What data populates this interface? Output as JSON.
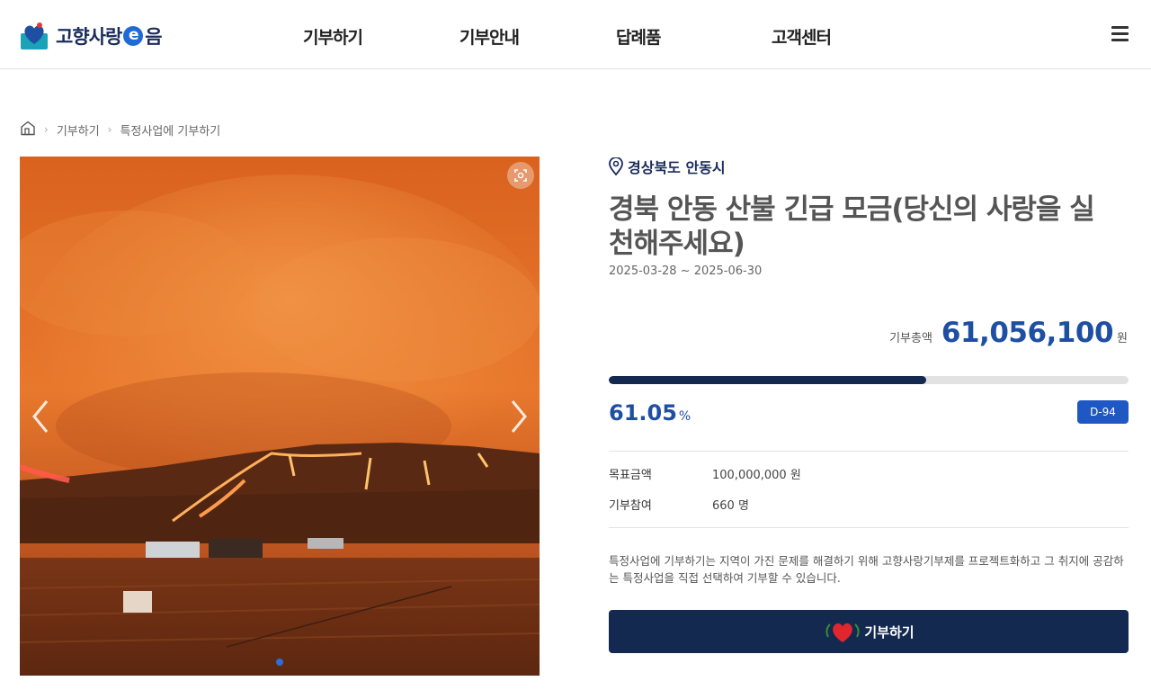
{
  "header": {
    "logo_text_1": "고향사랑",
    "logo_e": "e",
    "logo_text_2": "음",
    "nav": [
      "기부하기",
      "기부안내",
      "답례품",
      "고객센터"
    ],
    "menu_icon": "hamburger-icon"
  },
  "breadcrumb": {
    "home_icon": "home-icon",
    "items": [
      "기부하기",
      "특정사업에 기부하기"
    ]
  },
  "slider": {
    "zoom_icon": "zoom-icon",
    "prev_icon": "chevron-left-icon",
    "next_icon": "chevron-right-icon",
    "active_index": 1,
    "total": 1
  },
  "project": {
    "region": "경상북도 안동시",
    "title": "경북 안동 산불 긴급 모금(당신의 사랑을 실천해주세요)",
    "period": "2025-03-28 ~ 2025-06-30",
    "total_label": "기부총액",
    "total_value": "61,056,100",
    "total_unit": "원",
    "progress_percent": 61.05,
    "percent_value": "61.05",
    "percent_unit": "%",
    "dday": "D-94",
    "target_label": "목표금액",
    "target_value": "100,000,000 원",
    "participants_label": "기부참여",
    "participants_value": "660 명",
    "description": "특정사업에 기부하기는 지역이 가진 문제를 해결하기 위해 고향사랑기부제를 프로젝트화하고 그 취지에 공감하는 특정사업을 직접 선택하여 기부할 수 있습니다.",
    "donate_label": "기부하기"
  },
  "colors": {
    "navy": "#13294f",
    "accent_blue": "#1f4fa3",
    "dday_blue": "#1f57c4"
  }
}
